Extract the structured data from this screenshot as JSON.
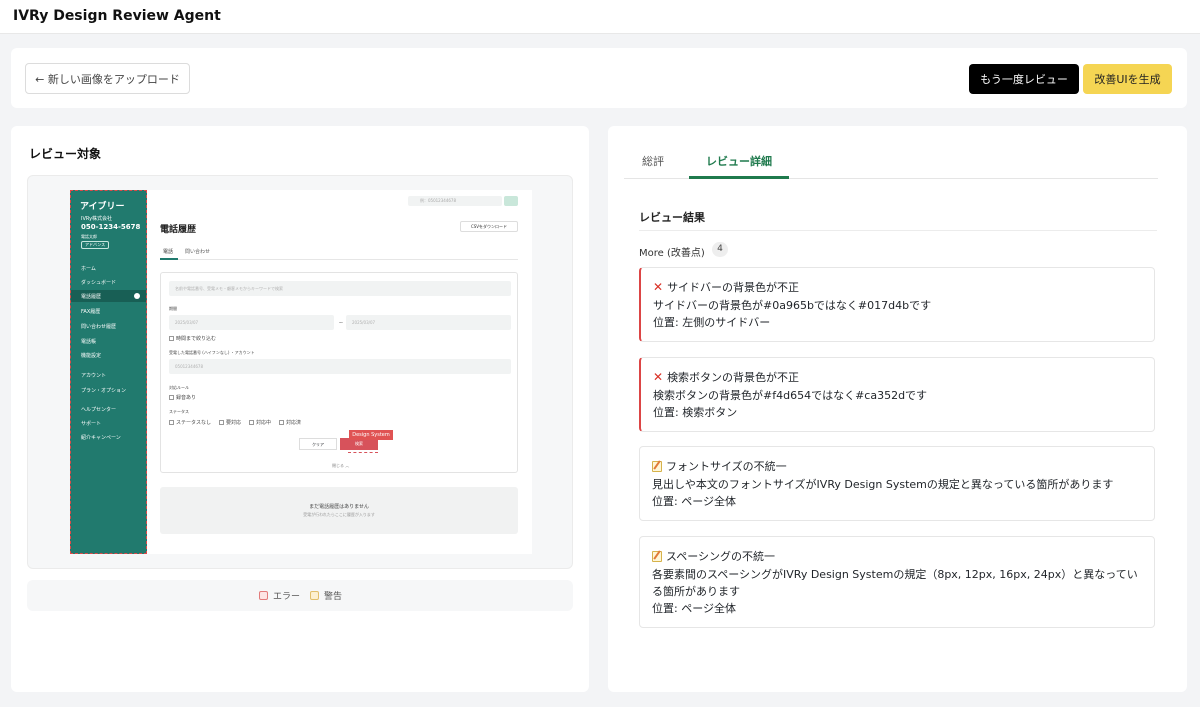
{
  "app": {
    "title": "IVRy Design Review Agent"
  },
  "toolbar": {
    "upload_label": "← 新しい画像をアップロード",
    "rereview_label": "もう一度レビュー",
    "generate_label": "改善UIを生成"
  },
  "left": {
    "title": "レビュー対象",
    "legend": {
      "error": "エラー",
      "warning": "警告"
    }
  },
  "mock": {
    "logo": "アイブリー",
    "company": "IVRy株式会社",
    "phone": "050-1234-5678",
    "user": "電話太郎",
    "plan": "アドバンス",
    "nav": [
      "ホーム",
      "ダッシュボード",
      "電話履歴",
      "FAX履歴",
      "問い合わせ履歴",
      "電話帳",
      "機能設定",
      "アカウント",
      "プラン・オプション",
      "ヘルプセンター",
      "サポート",
      "紹介キャンペーン"
    ],
    "heading": "電話履歴",
    "top_search": "例：05012344678",
    "csv": "CSVをダウンロード",
    "tabs": [
      "電話",
      "問い合わせ"
    ],
    "keyword_placeholder": "名前や電話番号、受電メモ・顧客メモからキーワードで検索",
    "period_label": "期間",
    "date_from": "2025/03/07",
    "date_to": "2025/03/07",
    "date_sep": "〜",
    "time_narrow": "時間まで絞り込む",
    "number_label": "受電した電話番号 (ハイフンなし) ・アカウント",
    "number_placeholder": "05012344678",
    "rule_label": "対応ルール",
    "rule_option": "録音あり",
    "status_label": "ステータス",
    "status_options": [
      "ステータスなし",
      "要対応",
      "対応中",
      "対応済"
    ],
    "clear": "クリア",
    "search": "検索",
    "design_system": "Design System",
    "collapse": "閉じる ︿",
    "empty_title": "まだ電話履歴はありません",
    "empty_sub": "受電が行われたらここに履歴が入ります"
  },
  "right": {
    "tabs": {
      "summary": "総評",
      "detail": "レビュー詳細"
    },
    "section_title": "レビュー結果",
    "more_label": "More (改善点)",
    "more_count": "4",
    "cards": [
      {
        "type": "error",
        "title": "サイドバーの背景色が不正",
        "desc": "サイドバーの背景色が#0a965bではなく#017d4bです",
        "location": "位置: 左側のサイドバー"
      },
      {
        "type": "error",
        "title": "検索ボタンの背景色が不正",
        "desc": "検索ボタンの背景色が#f4d654ではなく#ca352dです",
        "location": "位置: 検索ボタン"
      },
      {
        "type": "warning",
        "title": "フォントサイズの不統一",
        "desc": "見出しや本文のフォントサイズがIVRy Design Systemの規定と異なっている箇所があります",
        "location": "位置: ページ全体"
      },
      {
        "type": "warning",
        "title": "スペーシングの不統一",
        "desc": "各要素間のスペーシングがIVRy Design Systemの規定（8px, 12px, 16px, 24px）と異なっている箇所があります",
        "location": "位置: ページ全体"
      }
    ]
  },
  "colors": {
    "accent": "#1f7a4d",
    "error": "#dc4545",
    "sidebar": "#217a6e",
    "generate": "#f5d553"
  }
}
